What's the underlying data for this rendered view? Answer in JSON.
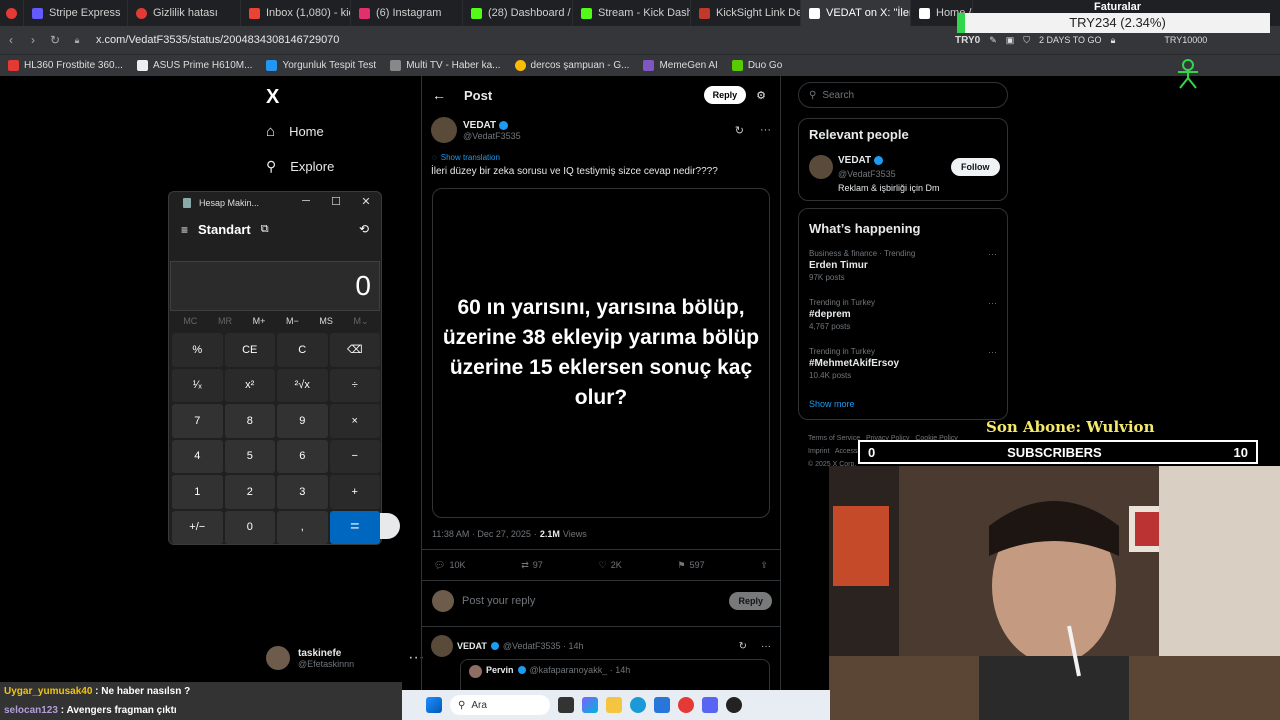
{
  "browser": {
    "tabs": [
      {
        "label": "Stripe Express",
        "color": "#635bff"
      },
      {
        "label": "Gizlilik hatası",
        "color": "#e53935"
      },
      {
        "label": "Inbox (1,080) - kicktaskin",
        "color": "#ea4335"
      },
      {
        "label": "(6) Instagram",
        "color": "#e1306c"
      },
      {
        "label": "(28) Dashboard / Stream",
        "color": "#53fc18"
      },
      {
        "label": "Stream - Kick Dashboard",
        "color": "#53fc18"
      },
      {
        "label": "KickSight Link Detector",
        "color": "#c0392b"
      },
      {
        "label": "VEDAT on X: \"İleri düzey b",
        "color": "#ffffff",
        "active": true
      },
      {
        "label": "Home / X",
        "color": "#ffffff"
      }
    ],
    "url": "x.com/VedatF3535/status/2004834308146729070",
    "bookmarks": [
      {
        "label": "HL360 Frostbite 360...",
        "color": "#e53935"
      },
      {
        "label": "ASUS Prime H610M...",
        "color": "#1a1a1a"
      },
      {
        "label": "Yorgunluk Tespit Test",
        "color": "#2196f3"
      },
      {
        "label": "Multi TV - Haber ka...",
        "color": "#888888"
      },
      {
        "label": "dercos şampuan - G...",
        "color": "#fbbc05"
      },
      {
        "label": "MemeGen AI",
        "color": "#7e57c2"
      },
      {
        "label": "Duo Go",
        "color": "#58cc02"
      }
    ]
  },
  "overlay": {
    "faturalar": "Faturalar",
    "ticker": "TRY234 (2.34%)",
    "ext_try": "TRY0",
    "ext_days": "2 DAYS TO GO",
    "ext_try2": "TRY10000",
    "sub_banner": "Son Abone: Wulvion",
    "sub_left": "0",
    "sub_label": "SUBSCRIBERS",
    "sub_right": "10"
  },
  "x_nav": {
    "logo": "X",
    "home": "Home",
    "explore": "Explore",
    "account_name": "taskinefe",
    "account_handle": "@Efetaskinnn"
  },
  "calculator": {
    "title": "Hesap Makin...",
    "mode": "Standart",
    "display": "0",
    "memory": [
      "MC",
      "MR",
      "M+",
      "M−",
      "MS",
      "M⌄"
    ],
    "keys": [
      "%",
      "CE",
      "C",
      "⌫",
      "¹⁄ₓ",
      "x²",
      "²√x",
      "÷",
      "7",
      "8",
      "9",
      "×",
      "4",
      "5",
      "6",
      "−",
      "1",
      "2",
      "3",
      "+",
      "+/−",
      "0",
      ",",
      "="
    ]
  },
  "post": {
    "header": "Post",
    "reply_button": "Reply",
    "author_name": "VEDAT",
    "author_handle": "@VedatF3535",
    "show_translation": "Show translation",
    "text": "İleri düzey bir zeka sorusu ve IQ testiymiş sizce cevap nedir????",
    "image_text": "60 ın yarısını, yarısına bölüp, üzerine 38 ekleyip yarıma bölüp üzerine 15 eklersen sonuç kaç olur?",
    "time": "11:38 AM · Dec 27, 2025",
    "views_count": "2.1M",
    "views_label": "Views",
    "stats": {
      "replies": "10K",
      "reposts": "97",
      "likes": "2K",
      "bookmarks": "597"
    },
    "reply_placeholder": "Post your reply",
    "reply_submit": "Reply",
    "reply_author": "VEDAT",
    "reply_handle": "@VedatF3535 · 14h",
    "quoted_author": "Pervin",
    "quoted_handle": "@kafaparanoyakk_ · 14h"
  },
  "sidebar": {
    "search_placeholder": "Search",
    "relevant_title": "Relevant people",
    "person_name": "VEDAT",
    "person_handle": "@VedatF3535",
    "person_bio": "Reklam & işbirliği için Dm",
    "follow": "Follow",
    "happening_title": "What’s happening",
    "trends": [
      {
        "category": "Business & finance · Trending",
        "name": "Erden Timur",
        "count": "97K posts"
      },
      {
        "category": "Trending in Turkey",
        "name": "#deprem",
        "count": "4,767 posts"
      },
      {
        "category": "Trending in Turkey",
        "name": "#MehmetAkifErsoy",
        "count": "10.4K posts"
      }
    ],
    "show_more": "Show more",
    "footer": "Terms of Service   Privacy Policy   Cookie Policy",
    "footer2": "Imprint   Accessibility   Ads info   More ···",
    "copyright": "© 2025 X Corp."
  },
  "chat": [
    {
      "user": "Uygar_yumusak40",
      "message": "Ne haber nasılsn ?",
      "user_color": "#f1c40f"
    },
    {
      "user": "selocan123",
      "message": "Avengers fragman çıktı",
      "user_color": "#b39ddb"
    }
  ],
  "taskbar": {
    "search_placeholder": "Ara"
  }
}
